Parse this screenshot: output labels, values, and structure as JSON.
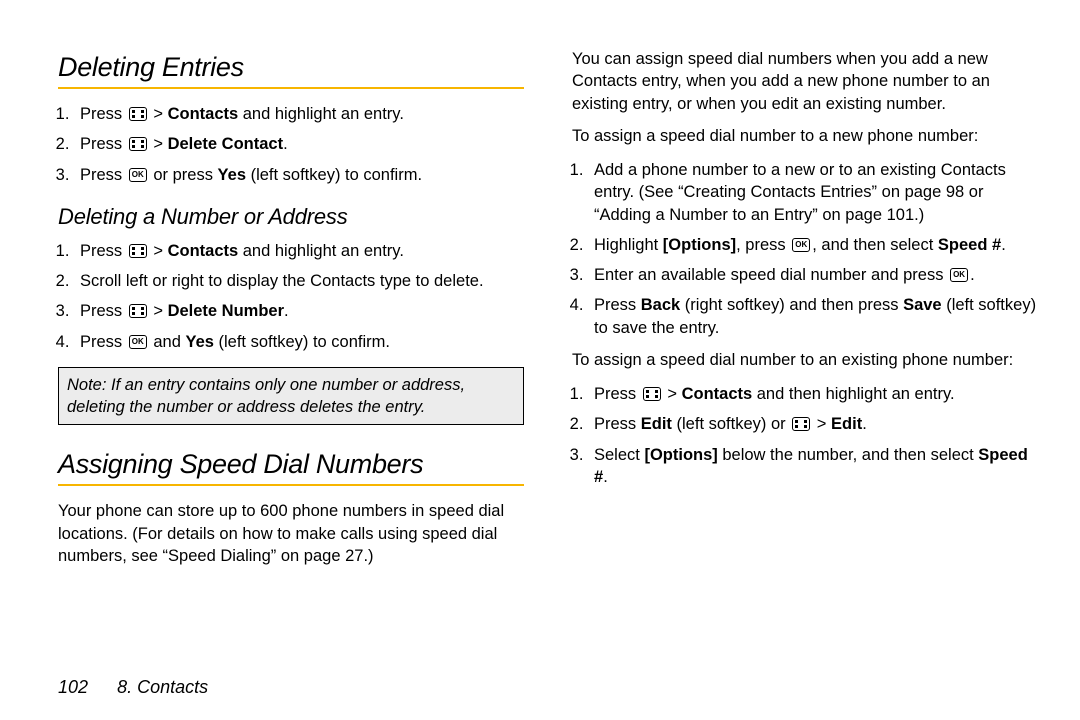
{
  "left": {
    "h_delete_entries": "Deleting Entries",
    "de_items": [
      {
        "pre": "Press ",
        "icon": "menu",
        "gt": " > ",
        "bold": "Contacts",
        "post": " and highlight an entry."
      },
      {
        "pre": "Press ",
        "icon": "menu",
        "gt": " > ",
        "bold": "Delete Contact",
        "post": "."
      },
      {
        "pre": "Press ",
        "icon": "ok",
        "mid": " or press ",
        "bold": "Yes",
        "post": " (left softkey) to confirm."
      }
    ],
    "h_delete_number": "Deleting a Number or Address",
    "dn_items": [
      {
        "pre": "Press ",
        "icon": "menu",
        "gt": " > ",
        "bold": "Contacts",
        "post": " and highlight an entry."
      },
      {
        "plain": "Scroll left or right to display the Contacts type to delete."
      },
      {
        "pre": "Press ",
        "icon": "menu",
        "gt": " > ",
        "bold": "Delete Number",
        "post": "."
      },
      {
        "pre": "Press ",
        "icon": "ok",
        "mid": " and ",
        "bold": "Yes",
        "post": " (left softkey) to confirm."
      }
    ],
    "note_label": "Note:",
    "note_body": "If an entry contains only one number or address, deleting the number or address deletes the entry.",
    "h_speed": "Assigning Speed Dial Numbers",
    "speed_para": "Your phone can store up to 600 phone numbers in speed dial locations. (For details on how to make calls using speed dial numbers, see “Speed Dialing” on page 27.)"
  },
  "right": {
    "intro": "You can assign speed dial numbers when you add a new Contacts entry, when you add a new phone number to an existing entry, or when you edit an existing number.",
    "lead1": "To assign a speed dial number to a new phone number:",
    "list1": [
      {
        "plain": "Add a phone number to a new or to an existing Contacts entry. (See “Creating Contacts Entries” on page 98 or “Adding a Number to an Entry” on page 101.)"
      },
      {
        "pre": "Highlight ",
        "bold": "[Options]",
        "mid": ", press ",
        "icon": "ok",
        "mid2": ", and then select ",
        "bold2": "Speed #",
        "post": "."
      },
      {
        "pre": "Enter an available speed dial number and press ",
        "icon": "ok",
        "post": "."
      },
      {
        "pre": "Press ",
        "bold": "Back",
        "mid": " (right softkey) and then press ",
        "bold2": "Save",
        "post": " (left softkey) to save the entry."
      }
    ],
    "lead2": "To assign a speed dial number to an existing phone number:",
    "list2": [
      {
        "pre": "Press ",
        "icon": "menu",
        "gt": " > ",
        "bold": "Contacts",
        "post": " and then highlight an entry."
      },
      {
        "pre": "Press ",
        "bold": "Edit",
        "mid": " (left softkey) or ",
        "icon": "menu",
        "gt2": " > ",
        "bold2": "Edit",
        "post": "."
      },
      {
        "pre": "Select ",
        "bold": "[Options]",
        "mid": " below the number, and then select ",
        "bold2": "Speed #",
        "post": "."
      }
    ]
  },
  "footer": {
    "page": "102",
    "chapter": "8. Contacts"
  }
}
